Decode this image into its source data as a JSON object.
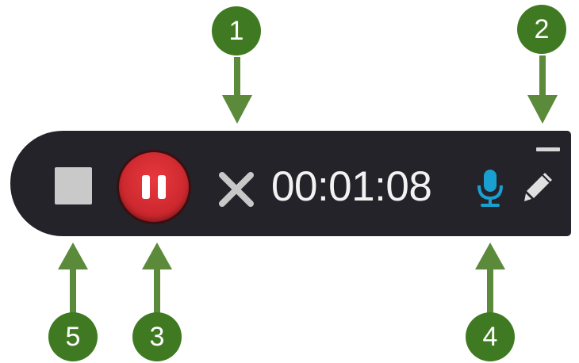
{
  "recorder": {
    "timer": "00:01:08",
    "accent_color": "#1aa0d0",
    "record_color": "#d62e34",
    "toolbar_color": "#242329",
    "icons": {
      "stop": "stop-square-icon",
      "pause": "pause-icon",
      "cancel": "close-x-icon",
      "microphone": "microphone-icon",
      "draw": "pencil-icon",
      "minimize": "minimize-icon"
    }
  },
  "callouts": {
    "c1": "1",
    "c2": "2",
    "c3": "3",
    "c4": "4",
    "c5": "5",
    "color": "#3f7a22"
  }
}
